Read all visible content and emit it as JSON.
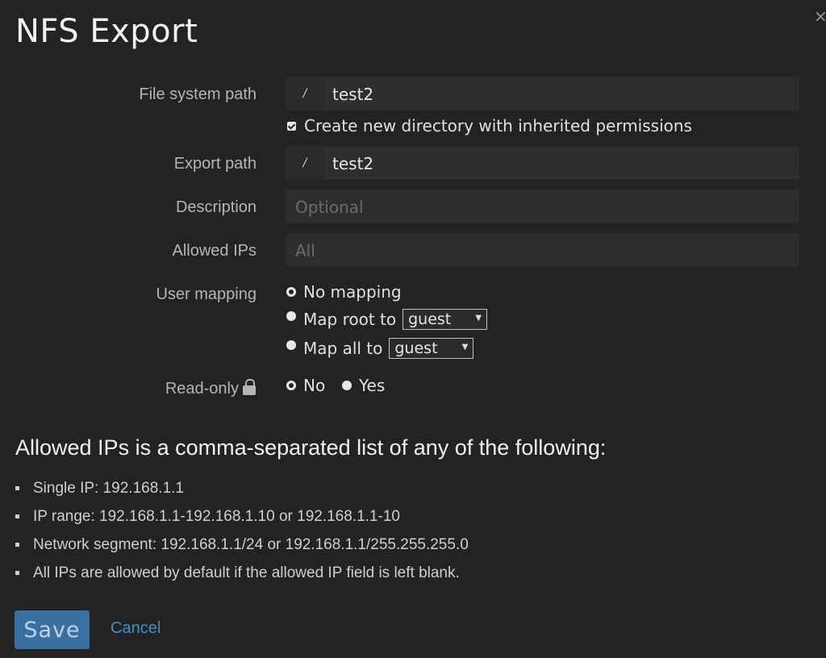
{
  "dialog": {
    "title": "NFS Export",
    "close_label": "×"
  },
  "form": {
    "fs_path": {
      "label": "File system path",
      "prefix": "/",
      "value": "test2"
    },
    "create_dir": {
      "label": "Create new directory with inherited permissions",
      "checked": true
    },
    "export_path": {
      "label": "Export path",
      "prefix": "/",
      "value": "test2"
    },
    "description": {
      "label": "Description",
      "value": "",
      "placeholder": "Optional"
    },
    "allowed_ips": {
      "label": "Allowed IPs",
      "value": "",
      "placeholder": "All"
    },
    "user_mapping": {
      "label": "User mapping",
      "options": [
        {
          "label": "No mapping",
          "selected": true
        },
        {
          "label": "Map root to",
          "selected": false,
          "select_value": "guest"
        },
        {
          "label": "Map all to",
          "selected": false,
          "select_value": "guest"
        }
      ]
    },
    "read_only": {
      "label": "Read-only",
      "icon": "lock-icon",
      "options": [
        {
          "label": "No",
          "selected": true
        },
        {
          "label": "Yes",
          "selected": false
        }
      ]
    }
  },
  "help": {
    "title": "Allowed IPs is a comma-separated list of any of the following:",
    "items": [
      "Single IP: 192.168.1.1",
      "IP range: 192.168.1.1-192.168.1.10 or 192.168.1.1-10",
      "Network segment: 192.168.1.1/24 or 192.168.1.1/255.255.255.0",
      "All IPs are allowed by default if the allowed IP field is left blank."
    ]
  },
  "actions": {
    "save_label": "Save",
    "cancel_label": "Cancel"
  },
  "colors": {
    "background": "#232323",
    "primary_button": "#3a6fa0",
    "link": "#3f8fd2"
  }
}
